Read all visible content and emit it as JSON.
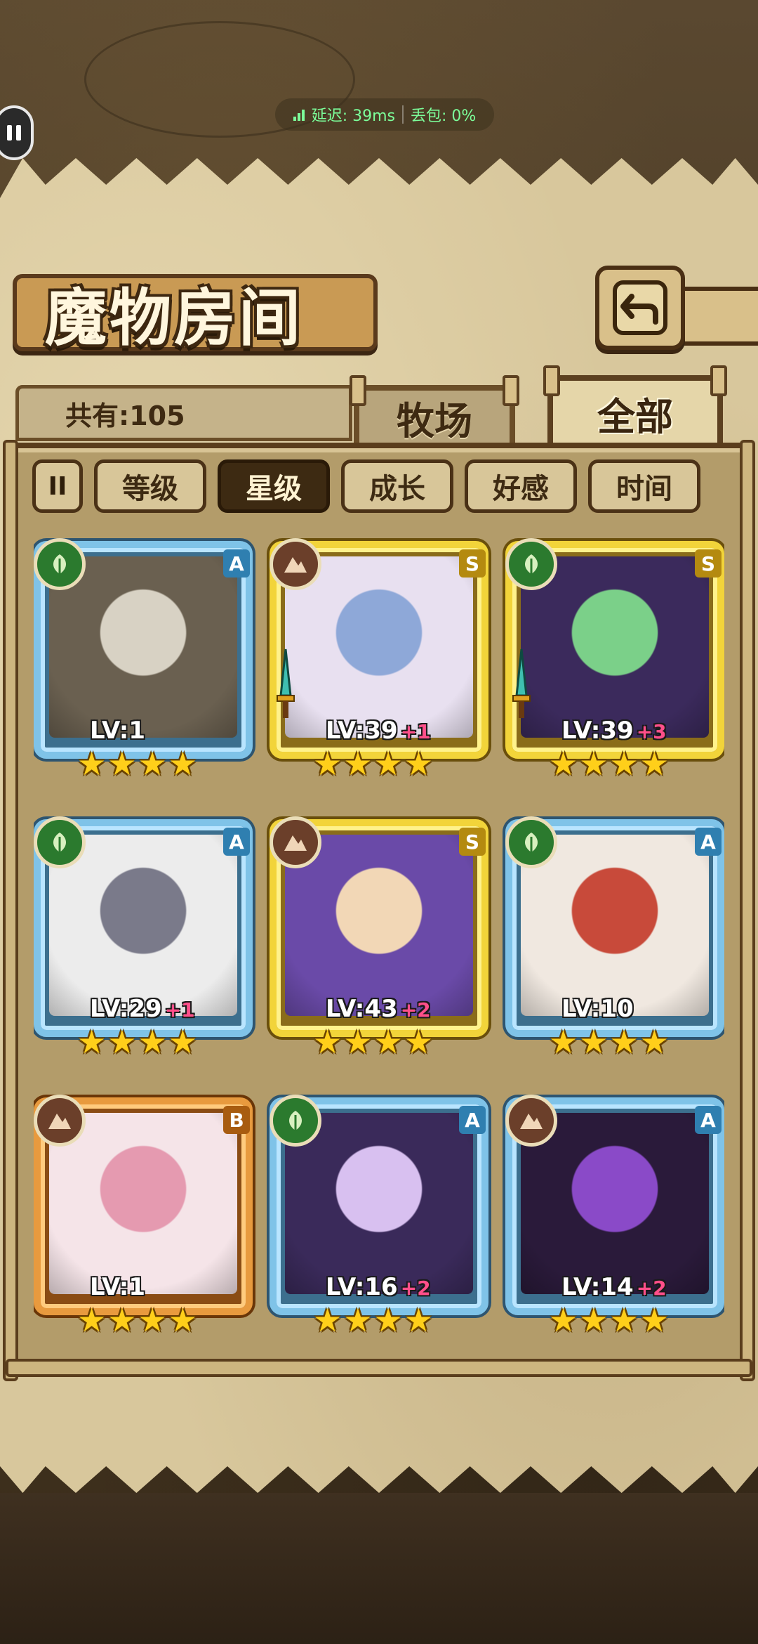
{
  "status": {
    "latency": "延迟: 39ms",
    "loss": "丢包: 0%"
  },
  "title": "魔物房间",
  "count_label": "共有:105",
  "tabs": {
    "ranch": "牧场",
    "all": "全部"
  },
  "sort": {
    "toggle_label": "II",
    "options": [
      "等级",
      "星级",
      "成长",
      "好感",
      "时间"
    ],
    "active": "星级"
  },
  "colors": {
    "rank_a": "#7fc3e8",
    "rank_s": "#f2d43a",
    "rank_b": "#e89a3e",
    "plus": "#ff4f8a",
    "star": "#ffcf1a"
  },
  "monsters": [
    {
      "rank": "A",
      "element": "leaf-icon",
      "level": "LV:1",
      "plus": "",
      "stars": 4
    },
    {
      "rank": "S",
      "element": "mountain-icon",
      "level": "LV:39",
      "plus": "+1",
      "stars": 4
    },
    {
      "rank": "S",
      "element": "leaf-icon",
      "level": "LV:39",
      "plus": "+3",
      "stars": 4
    },
    {
      "rank": "A",
      "element": "leaf-icon",
      "level": "LV:29",
      "plus": "+1",
      "stars": 4
    },
    {
      "rank": "S",
      "element": "mountain-icon",
      "level": "LV:43",
      "plus": "+2",
      "stars": 4
    },
    {
      "rank": "A",
      "element": "leaf-icon",
      "level": "LV:10",
      "plus": "",
      "stars": 4
    },
    {
      "rank": "B",
      "element": "mountain-icon",
      "level": "LV:1",
      "plus": "",
      "stars": 4
    },
    {
      "rank": "A",
      "element": "leaf-icon",
      "level": "LV:16",
      "plus": "+2",
      "stars": 4
    },
    {
      "rank": "A",
      "element": "mountain-icon",
      "level": "LV:14",
      "plus": "+2",
      "stars": 4
    }
  ]
}
